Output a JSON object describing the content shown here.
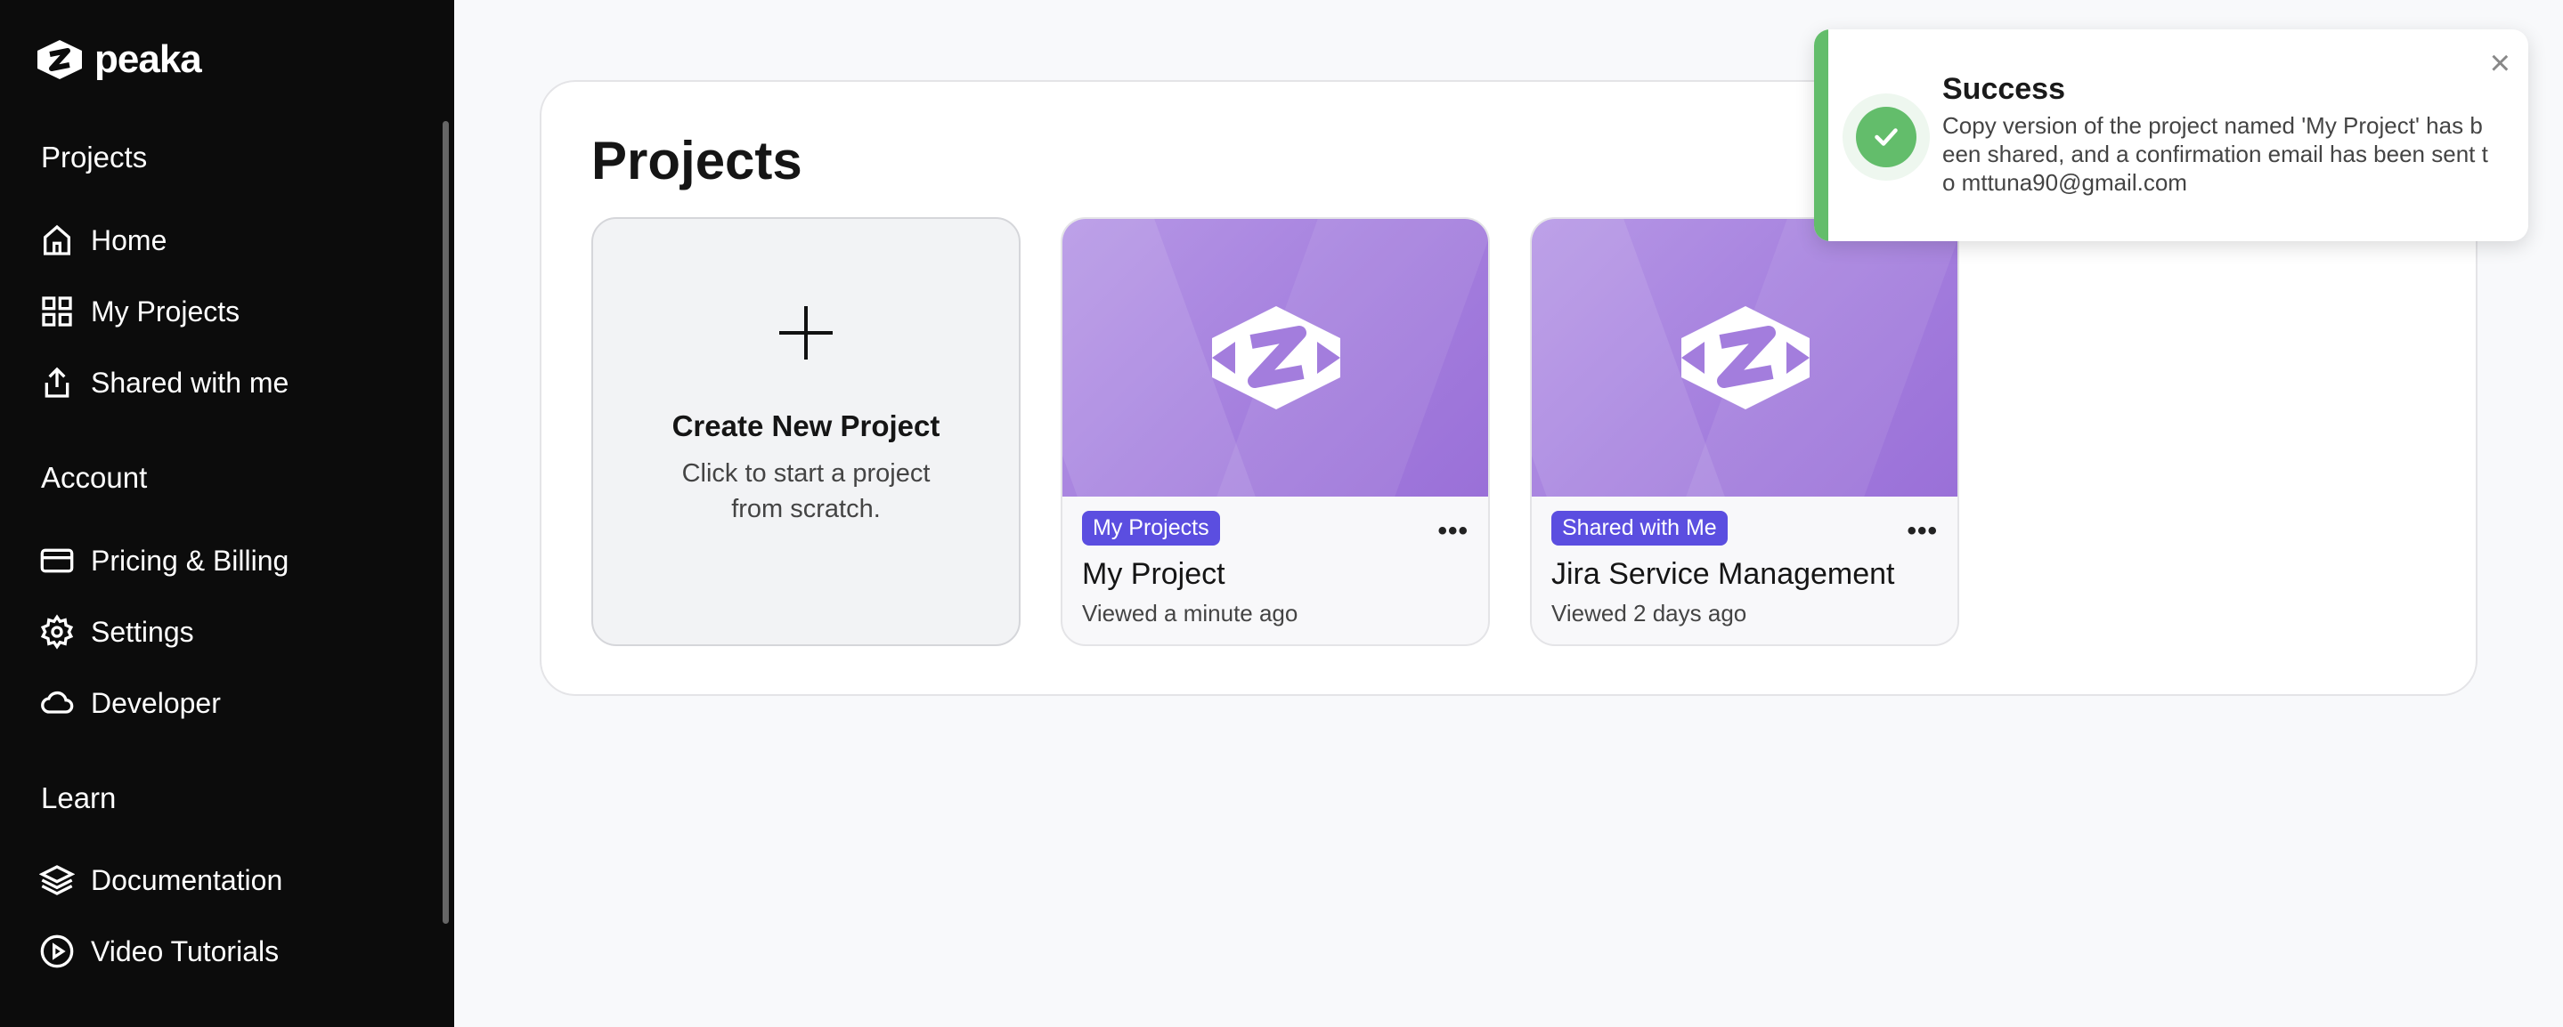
{
  "brand": {
    "name": "peaka"
  },
  "sidebar": {
    "sections": [
      {
        "title": "Projects",
        "items": [
          {
            "label": "Home",
            "icon": "home-icon"
          },
          {
            "label": "My Projects",
            "icon": "grid-icon"
          },
          {
            "label": "Shared with me",
            "icon": "share-icon"
          }
        ]
      },
      {
        "title": "Account",
        "items": [
          {
            "label": "Pricing & Billing",
            "icon": "credit-card-icon"
          },
          {
            "label": "Settings",
            "icon": "gear-icon"
          },
          {
            "label": "Developer",
            "icon": "cloud-icon"
          }
        ]
      },
      {
        "title": "Learn",
        "items": [
          {
            "label": "Documentation",
            "icon": "layers-icon"
          },
          {
            "label": "Video Tutorials",
            "icon": "play-circle-icon"
          }
        ]
      }
    ]
  },
  "main": {
    "title": "Projects",
    "new_card": {
      "title": "Create New Project",
      "description": "Click to start a project from scratch."
    },
    "projects": [
      {
        "badge": "My Projects",
        "name": "My Project",
        "viewed": "Viewed a minute ago"
      },
      {
        "badge": "Shared with Me",
        "name": "Jira Service Management",
        "viewed": "Viewed 2 days ago"
      }
    ]
  },
  "toast": {
    "title": "Success",
    "message": "Copy version of the project named 'My Project' has been shared, and a confirmation email has been sent to mttuna90@gmail.com",
    "accent": "#63bd6b"
  },
  "colors": {
    "sidebar_bg": "#0c0c0c",
    "badge_bg": "#5b4ee0",
    "thumb": "#a37ddd"
  }
}
